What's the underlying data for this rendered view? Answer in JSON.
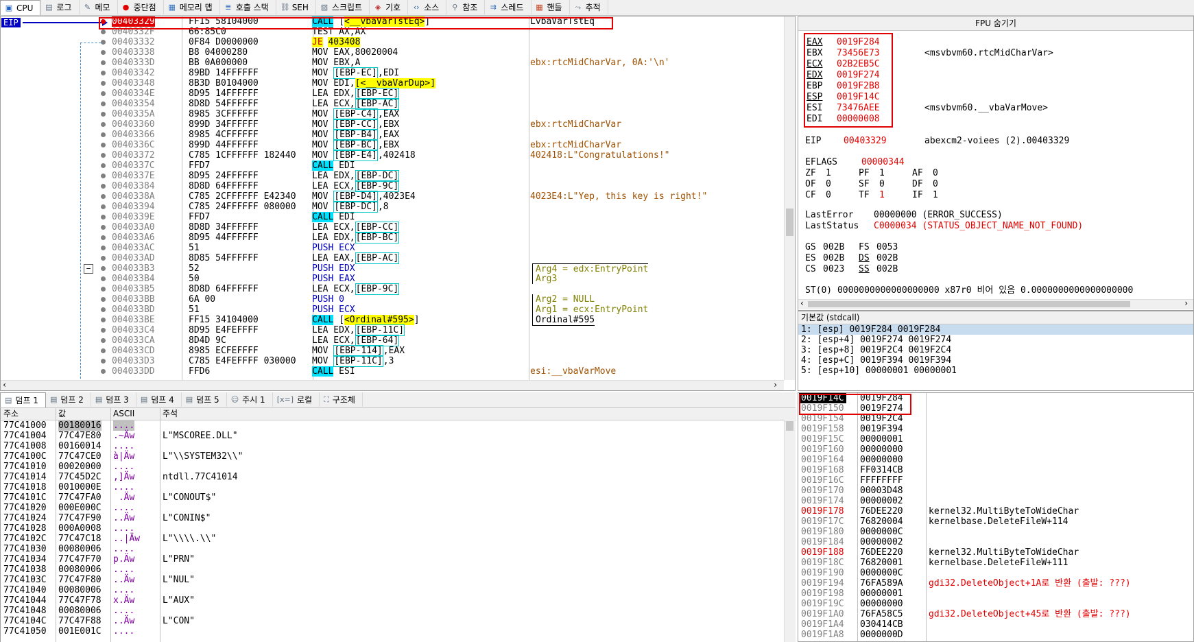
{
  "tabs": [
    {
      "label": "CPU",
      "icon": "cpu-icon",
      "glyph": "▣",
      "color": "#2060c0",
      "active": true
    },
    {
      "label": "로그",
      "icon": "log-icon",
      "glyph": "▤",
      "color": "#607080"
    },
    {
      "label": "메모",
      "icon": "notes-icon",
      "glyph": "✎",
      "color": "#607080"
    },
    {
      "label": "중단점",
      "icon": "breakpoint-icon",
      "glyph": "●",
      "color": "#e00000"
    },
    {
      "label": "메모리 맵",
      "icon": "memory-map-icon",
      "glyph": "▦",
      "color": "#3070c0"
    },
    {
      "label": "호출 스택",
      "icon": "call-stack-icon",
      "glyph": "≣",
      "color": "#3070c0"
    },
    {
      "label": "SEH",
      "icon": "seh-icon",
      "glyph": "⛓",
      "color": "#607080"
    },
    {
      "label": "스크립트",
      "icon": "script-icon",
      "glyph": "▧",
      "color": "#607080"
    },
    {
      "label": "기호",
      "icon": "symbols-icon",
      "glyph": "◈",
      "color": "#c03030"
    },
    {
      "label": "소스",
      "icon": "source-icon",
      "glyph": "‹›",
      "color": "#2060a0"
    },
    {
      "label": "참조",
      "icon": "references-icon",
      "glyph": "⚲",
      "color": "#607080"
    },
    {
      "label": "스레드",
      "icon": "threads-icon",
      "glyph": "⇉",
      "color": "#3070c0"
    },
    {
      "label": "핸들",
      "icon": "handles-icon",
      "glyph": "▦",
      "color": "#c04020"
    },
    {
      "label": "추적",
      "icon": "trace-icon",
      "glyph": "⤳",
      "color": "#607080"
    }
  ],
  "cpu": {
    "eip_label": "EIP",
    "rows": [
      {
        "addr": "00403329",
        "bytes": "FF15 58104000",
        "instr": [
          {
            "t": "CALL",
            "c": "call"
          },
          {
            "t": " ["
          },
          {
            "t": "<__vbaVarTstEq>",
            "c": "sym"
          },
          {
            "t": "]"
          }
        ],
        "cmt": "LvbaVarTstEq",
        "bp": true,
        "cur": true
      },
      {
        "addr": "0040332F",
        "bytes": "66:85C0",
        "instr": [
          {
            "t": "TEST AX,AX"
          }
        ],
        "cmt": ""
      },
      {
        "addr": "00403332",
        "bytes": "0F84 D0000000",
        "instr": [
          {
            "t": "JE",
            "c": "jmp"
          },
          {
            "t": " "
          },
          {
            "t": "403408",
            "c": "sym"
          }
        ],
        "cmt": ""
      },
      {
        "addr": "00403338",
        "bytes": "B8 04000280",
        "instr": [
          {
            "t": "MOV EAX,80020004"
          }
        ],
        "cmt": ""
      },
      {
        "addr": "0040333D",
        "bytes": "BB 0A000000",
        "instr": [
          {
            "t": "MOV EBX,A"
          }
        ],
        "cmt": "ebx:rtcMidCharVar, 0A:'\\n'"
      },
      {
        "addr": "00403342",
        "bytes": "89BD 14FFFFFF",
        "instr": [
          {
            "t": "MOV "
          },
          {
            "t": "[EBP-EC]",
            "c": "mem"
          },
          {
            "t": ",EDI"
          }
        ],
        "cmt": ""
      },
      {
        "addr": "00403348",
        "bytes": "8B3D B0104000",
        "instr": [
          {
            "t": "MOV EDI,"
          },
          {
            "t": "[<__vbaVarDup>]",
            "c": "sym"
          }
        ],
        "cmt": ""
      },
      {
        "addr": "0040334E",
        "bytes": "8D95 14FFFFFF",
        "instr": [
          {
            "t": "LEA EDX,"
          },
          {
            "t": "[EBP-EC]",
            "c": "mem"
          }
        ],
        "cmt": ""
      },
      {
        "addr": "00403354",
        "bytes": "8D8D 54FFFFFF",
        "instr": [
          {
            "t": "LEA ECX,"
          },
          {
            "t": "[EBP-AC]",
            "c": "mem"
          }
        ],
        "cmt": ""
      },
      {
        "addr": "0040335A",
        "bytes": "8985 3CFFFFFF",
        "instr": [
          {
            "t": "MOV "
          },
          {
            "t": "[EBP-C4]",
            "c": "mem"
          },
          {
            "t": ",EAX"
          }
        ],
        "cmt": ""
      },
      {
        "addr": "00403360",
        "bytes": "899D 34FFFFFF",
        "instr": [
          {
            "t": "MOV "
          },
          {
            "t": "[EBP-CC]",
            "c": "mem"
          },
          {
            "t": ",EBX"
          }
        ],
        "cmt": "ebx:rtcMidCharVar"
      },
      {
        "addr": "00403366",
        "bytes": "8985 4CFFFFFF",
        "instr": [
          {
            "t": "MOV "
          },
          {
            "t": "[EBP-B4]",
            "c": "mem"
          },
          {
            "t": ",EAX"
          }
        ],
        "cmt": ""
      },
      {
        "addr": "0040336C",
        "bytes": "899D 44FFFFFF",
        "instr": [
          {
            "t": "MOV "
          },
          {
            "t": "[EBP-BC]",
            "c": "mem"
          },
          {
            "t": ",EBX"
          }
        ],
        "cmt": "ebx:rtcMidCharVar"
      },
      {
        "addr": "00403372",
        "bytes": "C785 1CFFFFFF 182440",
        "instr": [
          {
            "t": "MOV "
          },
          {
            "t": "[EBP-E4]",
            "c": "mem"
          },
          {
            "t": ",402418"
          }
        ],
        "cmt": "402418:L\"Congratulations!\""
      },
      {
        "addr": "0040337C",
        "bytes": "FFD7",
        "instr": [
          {
            "t": "CALL",
            "c": "call"
          },
          {
            "t": " EDI"
          }
        ],
        "cmt": ""
      },
      {
        "addr": "0040337E",
        "bytes": "8D95 24FFFFFF",
        "instr": [
          {
            "t": "LEA EDX,"
          },
          {
            "t": "[EBP-DC]",
            "c": "mem"
          }
        ],
        "cmt": ""
      },
      {
        "addr": "00403384",
        "bytes": "8D8D 64FFFFFF",
        "instr": [
          {
            "t": "LEA ECX,"
          },
          {
            "t": "[EBP-9C]",
            "c": "mem"
          }
        ],
        "cmt": ""
      },
      {
        "addr": "0040338A",
        "bytes": "C785 2CFFFFFF E42340",
        "instr": [
          {
            "t": "MOV "
          },
          {
            "t": "[EBP-D4]",
            "c": "mem"
          },
          {
            "t": ",4023E4"
          }
        ],
        "cmt": "4023E4:L\"Yep, this key is right!\""
      },
      {
        "addr": "00403394",
        "bytes": "C785 24FFFFFF 080000",
        "instr": [
          {
            "t": "MOV "
          },
          {
            "t": "[EBP-DC]",
            "c": "mem"
          },
          {
            "t": ",8"
          }
        ],
        "cmt": ""
      },
      {
        "addr": "0040339E",
        "bytes": "FFD7",
        "instr": [
          {
            "t": "CALL",
            "c": "call"
          },
          {
            "t": " EDI"
          }
        ],
        "cmt": ""
      },
      {
        "addr": "004033A0",
        "bytes": "8D8D 34FFFFFF",
        "instr": [
          {
            "t": "LEA ECX,"
          },
          {
            "t": "[EBP-CC]",
            "c": "mem"
          }
        ],
        "cmt": ""
      },
      {
        "addr": "004033A6",
        "bytes": "8D95 44FFFFFF",
        "instr": [
          {
            "t": "LEA EDX,"
          },
          {
            "t": "[EBP-BC]",
            "c": "mem"
          }
        ],
        "cmt": ""
      },
      {
        "addr": "004033AC",
        "bytes": "51",
        "instr": [
          {
            "t": "PUSH",
            "c": "push"
          },
          {
            "t": " ECX",
            "c": "push"
          }
        ],
        "cmt": ""
      },
      {
        "addr": "004033AD",
        "bytes": "8D85 54FFFFFF",
        "instr": [
          {
            "t": "LEA EAX,"
          },
          {
            "t": "[EBP-AC]",
            "c": "mem"
          }
        ],
        "cmt": ""
      },
      {
        "addr": "004033B3",
        "bytes": "52",
        "instr": [
          {
            "t": "PUSH",
            "c": "push"
          },
          {
            "t": " EDX",
            "c": "push"
          }
        ],
        "cmt": "Arg4 = edx:EntryPoint",
        "cc": "arg",
        "brk": "top"
      },
      {
        "addr": "004033B4",
        "bytes": "50",
        "instr": [
          {
            "t": "PUSH",
            "c": "push"
          },
          {
            "t": " EAX",
            "c": "push"
          }
        ],
        "cmt": "Arg3",
        "cc": "arg",
        "brk": "mid"
      },
      {
        "addr": "004033B5",
        "bytes": "8D8D 64FFFFFF",
        "instr": [
          {
            "t": "LEA ECX,"
          },
          {
            "t": "[EBP-9C]",
            "c": "mem"
          }
        ],
        "cmt": "",
        "brk": "mid"
      },
      {
        "addr": "004033BB",
        "bytes": "6A 00",
        "instr": [
          {
            "t": "PUSH",
            "c": "push"
          },
          {
            "t": " 0",
            "c": "push"
          }
        ],
        "cmt": "Arg2 = NULL",
        "cc": "arg",
        "brk": "mid"
      },
      {
        "addr": "004033BD",
        "bytes": "51",
        "instr": [
          {
            "t": "PUSH",
            "c": "push"
          },
          {
            "t": " ECX",
            "c": "push"
          }
        ],
        "cmt": "Arg1 = ecx:EntryPoint",
        "cc": "arg",
        "brk": "mid"
      },
      {
        "addr": "004033BE",
        "bytes": "FF15 34104000",
        "instr": [
          {
            "t": "CALL",
            "c": "call"
          },
          {
            "t": " ["
          },
          {
            "t": "<Ordinal#595>",
            "c": "sym"
          },
          {
            "t": "]"
          }
        ],
        "cmt": "Ordinal#595",
        "brk": "bot"
      },
      {
        "addr": "004033C4",
        "bytes": "8D95 E4FEFFFF",
        "instr": [
          {
            "t": "LEA EDX,"
          },
          {
            "t": "[EBP-11C]",
            "c": "mem"
          }
        ],
        "cmt": ""
      },
      {
        "addr": "004033CA",
        "bytes": "8D4D 9C",
        "instr": [
          {
            "t": "LEA ECX,"
          },
          {
            "t": "[EBP-64]",
            "c": "mem"
          }
        ],
        "cmt": ""
      },
      {
        "addr": "004033CD",
        "bytes": "8985 ECFEFFFF",
        "instr": [
          {
            "t": "MOV "
          },
          {
            "t": "[EBP-114]",
            "c": "mem"
          },
          {
            "t": ",EAX"
          }
        ],
        "cmt": ""
      },
      {
        "addr": "004033D3",
        "bytes": "C785 E4FEFFFF 030000",
        "instr": [
          {
            "t": "MOV "
          },
          {
            "t": "[EBP-11C]",
            "c": "mem"
          },
          {
            "t": ",3"
          }
        ],
        "cmt": ""
      },
      {
        "addr": "004033DD",
        "bytes": "FFD6",
        "instr": [
          {
            "t": "CALL",
            "c": "call"
          },
          {
            "t": " ESI"
          }
        ],
        "cmt": "esi:__vbaVarMove"
      }
    ]
  },
  "fpu": {
    "title": "FPU 숨기기",
    "regs": [
      {
        "name": "EAX",
        "u": true,
        "val": "0019F284",
        "red": true,
        "cmt": ""
      },
      {
        "name": "EBX",
        "u": false,
        "val": "73456E73",
        "red": true,
        "cmt": "<msvbvm60.rtcMidCharVar>"
      },
      {
        "name": "ECX",
        "u": true,
        "val": "02B2EB5C",
        "red": true,
        "cmt": ""
      },
      {
        "name": "EDX",
        "u": true,
        "val": "0019F274",
        "red": true,
        "cmt": ""
      },
      {
        "name": "EBP",
        "u": false,
        "val": "0019F2B8",
        "red": true,
        "cmt": ""
      },
      {
        "name": "ESP",
        "u": true,
        "val": "0019F14C",
        "red": true,
        "cmt": ""
      },
      {
        "name": "ESI",
        "u": false,
        "val": "73476AEE",
        "red": true,
        "cmt": "<msvbvm60.__vbaVarMove>"
      },
      {
        "name": "EDI",
        "u": false,
        "val": "00000008",
        "red": true,
        "cmt": ""
      }
    ],
    "eip": {
      "name": "EIP",
      "val": "00403329",
      "cmt": "abexcm2-voiees (2).00403329"
    },
    "eflags": {
      "name": "EFLAGS",
      "val": "00000344"
    },
    "flags": [
      [
        "ZF",
        "1",
        "PF",
        "1",
        "AF",
        "0"
      ],
      [
        "OF",
        "0",
        "SF",
        "0",
        "DF",
        "0"
      ],
      [
        "CF",
        "0",
        "TF",
        "1",
        "IF",
        "1"
      ]
    ],
    "lasterror": {
      "name": "LastError",
      "val": "00000000 (ERROR_SUCCESS)"
    },
    "laststatus": {
      "name": "LastStatus",
      "val": "C0000034 (STATUS_OBJECT_NAME_NOT_FOUND)"
    },
    "segs": [
      [
        "GS",
        "002B",
        "FS",
        "0053"
      ],
      [
        "ES",
        "002B",
        "DS",
        "002B"
      ],
      [
        "CS",
        "0023",
        "SS",
        "002B"
      ]
    ],
    "st0": "ST(0) 0000000000000000000 x87r0 비어 있음 0.0000000000000000000"
  },
  "args": {
    "header": "기본값 (stdcall)",
    "rows": [
      "1: [esp] 0019F284 0019F284",
      "2: [esp+4] 0019F274 0019F274",
      "3: [esp+8] 0019F2C4 0019F2C4",
      "4: [esp+C] 0019F394 0019F394",
      "5: [esp+10] 00000001 00000001"
    ]
  },
  "dumptabs": [
    {
      "label": "덤프 1",
      "icon": "dump-icon",
      "glyph": "▤",
      "active": true
    },
    {
      "label": "덤프 2",
      "icon": "dump-icon",
      "glyph": "▤"
    },
    {
      "label": "덤프 3",
      "icon": "dump-icon",
      "glyph": "▤"
    },
    {
      "label": "덤프 4",
      "icon": "dump-icon",
      "glyph": "▤"
    },
    {
      "label": "덤프 5",
      "icon": "dump-icon",
      "glyph": "▤"
    },
    {
      "label": "주시 1",
      "icon": "watch-icon",
      "glyph": "☺"
    },
    {
      "label": "로컬",
      "icon": "locals-icon",
      "glyph": "[x=]"
    },
    {
      "label": "구조체",
      "icon": "struct-icon",
      "glyph": "⛶"
    }
  ],
  "dump": {
    "headers": {
      "addr": "주소",
      "val": "값",
      "ascii": "ASCII",
      "cmt": "주석"
    },
    "rows": [
      {
        "a": "77C41000",
        "v": "00180016",
        "s": "....",
        "c": ""
      },
      {
        "a": "77C41004",
        "v": "77C47E80",
        "s": ".~Äw",
        "c": "L\"MSCOREE.DLL\""
      },
      {
        "a": "77C41008",
        "v": "00160014",
        "s": "....",
        "c": ""
      },
      {
        "a": "77C4100C",
        "v": "77C47CE0",
        "s": "à|Äw",
        "c": "L\"\\\\SYSTEM32\\\\\""
      },
      {
        "a": "77C41010",
        "v": "00020000",
        "s": "....",
        "c": ""
      },
      {
        "a": "77C41014",
        "v": "77C45D2C",
        "s": ",]Äw",
        "c": "ntdll.77C41014"
      },
      {
        "a": "77C41018",
        "v": "0010000E",
        "s": "....",
        "c": ""
      },
      {
        "a": "77C4101C",
        "v": "77C47FA0",
        "s": " .Äw",
        "c": "L\"CONOUT$\""
      },
      {
        "a": "77C41020",
        "v": "000E000C",
        "s": "....",
        "c": ""
      },
      {
        "a": "77C41024",
        "v": "77C47F90",
        "s": "..Äw",
        "c": "L\"CONIN$\""
      },
      {
        "a": "77C41028",
        "v": "000A0008",
        "s": "....",
        "c": ""
      },
      {
        "a": "77C4102C",
        "v": "77C47C18",
        "s": "..|Äw",
        "c": "L\"\\\\\\\\.\\\\\""
      },
      {
        "a": "77C41030",
        "v": "00080006",
        "s": "....",
        "c": ""
      },
      {
        "a": "77C41034",
        "v": "77C47F70",
        "s": "p.Äw",
        "c": "L\"PRN\""
      },
      {
        "a": "77C41038",
        "v": "00080006",
        "s": "....",
        "c": ""
      },
      {
        "a": "77C4103C",
        "v": "77C47F80",
        "s": "..Äw",
        "c": "L\"NUL\""
      },
      {
        "a": "77C41040",
        "v": "00080006",
        "s": "....",
        "c": ""
      },
      {
        "a": "77C41044",
        "v": "77C47F78",
        "s": "x.Äw",
        "c": "L\"AUX\""
      },
      {
        "a": "77C41048",
        "v": "00080006",
        "s": "....",
        "c": ""
      },
      {
        "a": "77C4104C",
        "v": "77C47F88",
        "s": "..Äw",
        "c": "L\"CON\""
      },
      {
        "a": "77C41050",
        "v": "001E001C",
        "s": "....",
        "c": ""
      }
    ]
  },
  "stack": {
    "rows": [
      {
        "a": "0019F14C",
        "v": "0019F284",
        "c": "",
        "top": true
      },
      {
        "a": "0019F150",
        "v": "0019F274",
        "c": ""
      },
      {
        "a": "0019F154",
        "v": "0019F2C4",
        "c": ""
      },
      {
        "a": "0019F158",
        "v": "0019F394",
        "c": ""
      },
      {
        "a": "0019F15C",
        "v": "00000001",
        "c": ""
      },
      {
        "a": "0019F160",
        "v": "00000000",
        "c": ""
      },
      {
        "a": "0019F164",
        "v": "00000000",
        "c": ""
      },
      {
        "a": "0019F168",
        "v": "FF0314CB",
        "c": ""
      },
      {
        "a": "0019F16C",
        "v": "FFFFFFFF",
        "c": ""
      },
      {
        "a": "0019F170",
        "v": "00003D48",
        "c": ""
      },
      {
        "a": "0019F174",
        "v": "00000002",
        "c": ""
      },
      {
        "a": "0019F178",
        "v": "76DEE220",
        "c": "kernel32.MultiByteToWideChar",
        "hot": true
      },
      {
        "a": "0019F17C",
        "v": "76820004",
        "c": "kernelbase.DeleteFileW+114"
      },
      {
        "a": "0019F180",
        "v": "0000000C",
        "c": ""
      },
      {
        "a": "0019F184",
        "v": "00000002",
        "c": ""
      },
      {
        "a": "0019F188",
        "v": "76DEE220",
        "c": "kernel32.MultiByteToWideChar",
        "hot": true
      },
      {
        "a": "0019F18C",
        "v": "76820001",
        "c": "kernelbase.DeleteFileW+111"
      },
      {
        "a": "0019F190",
        "v": "0000000C",
        "c": ""
      },
      {
        "a": "0019F194",
        "v": "76FA589A",
        "c": "gdi32.DeleteObject+1A로 반환 (출발: ???)",
        "red": true
      },
      {
        "a": "0019F198",
        "v": "00000001",
        "c": ""
      },
      {
        "a": "0019F19C",
        "v": "00000000",
        "c": ""
      },
      {
        "a": "0019F1A0",
        "v": "76FA58C5",
        "c": "gdi32.DeleteObject+45로 반환 (출발: ???)",
        "red": true
      },
      {
        "a": "0019F1A4",
        "v": "030414CB",
        "c": ""
      },
      {
        "a": "0019F1A8",
        "v": "0000000D",
        "c": ""
      }
    ]
  }
}
